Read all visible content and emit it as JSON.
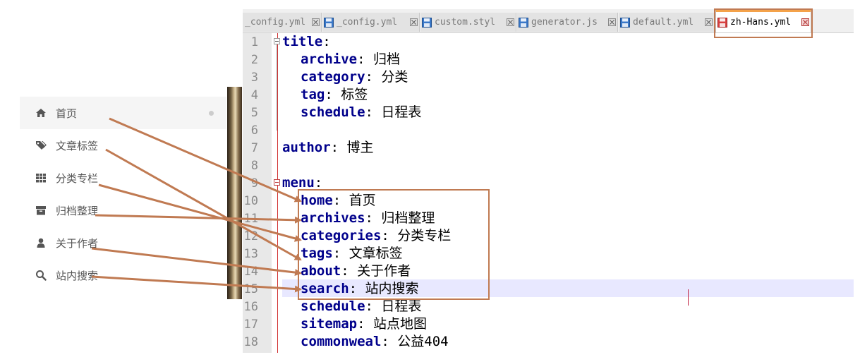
{
  "menu": {
    "items": [
      {
        "label": "首页",
        "icon": "home-icon",
        "active": true
      },
      {
        "label": "文章标签",
        "icon": "tags-icon",
        "active": false
      },
      {
        "label": "分类专栏",
        "icon": "th-icon",
        "active": false
      },
      {
        "label": "归档整理",
        "icon": "archive-icon",
        "active": false
      },
      {
        "label": "关于作者",
        "icon": "user-icon",
        "active": false
      },
      {
        "label": "站内搜索",
        "icon": "search-icon",
        "active": false
      }
    ]
  },
  "tabs": [
    {
      "label": "_config.yml"
    },
    {
      "label": "_config.yml"
    },
    {
      "label": "custom.styl"
    },
    {
      "label": "generator.js"
    },
    {
      "label": "default.yml"
    },
    {
      "label": "zh-Hans.yml",
      "active": true
    }
  ],
  "lines": [
    {
      "n": "1",
      "key": "title",
      "val": ""
    },
    {
      "n": "2",
      "key": "archive",
      "val": "归档"
    },
    {
      "n": "3",
      "key": "category",
      "val": "分类"
    },
    {
      "n": "4",
      "key": "tag",
      "val": "标签"
    },
    {
      "n": "5",
      "key": "schedule",
      "val": "日程表"
    },
    {
      "n": "6",
      "key": "",
      "val": ""
    },
    {
      "n": "7",
      "key": "author",
      "val": "博主"
    },
    {
      "n": "8",
      "key": "",
      "val": ""
    },
    {
      "n": "9",
      "key": "menu",
      "val": ""
    },
    {
      "n": "10",
      "key": "home",
      "val": "首页"
    },
    {
      "n": "11",
      "key": "archives",
      "val": "归档整理"
    },
    {
      "n": "12",
      "key": "categories",
      "val": "分类专栏"
    },
    {
      "n": "13",
      "key": "tags",
      "val": "文章标签"
    },
    {
      "n": "14",
      "key": "about",
      "val": "关于作者"
    },
    {
      "n": "15",
      "key": "search",
      "val": "站内搜索"
    },
    {
      "n": "16",
      "key": "schedule",
      "val": "日程表"
    },
    {
      "n": "17",
      "key": "sitemap",
      "val": "站点地图"
    },
    {
      "n": "18",
      "key": "commonweal",
      "val": "公益404"
    }
  ],
  "colors": {
    "annotation": "#c07a52",
    "key": "#00008b",
    "active_tab_accent": "#f4a24a"
  }
}
